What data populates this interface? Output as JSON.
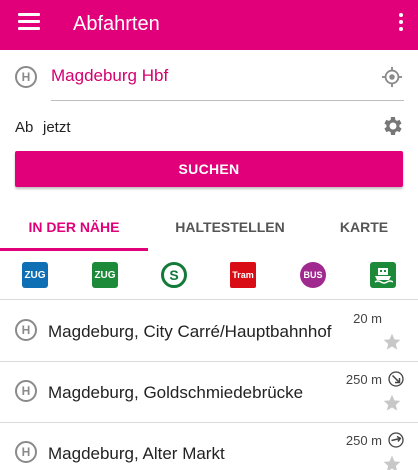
{
  "appbar": {
    "title": "Abfahrten",
    "menu_icon": "menu-icon",
    "more_icon": "more-vert-icon"
  },
  "search": {
    "station_icon": "H",
    "station_value": "Magdeburg Hbf",
    "time_label": "Ab",
    "time_value": "jetzt",
    "button_label": "SUCHEN"
  },
  "tabs": [
    {
      "label": "IN DER NÄHE",
      "active": true
    },
    {
      "label": "HALTESTELLEN",
      "active": false
    },
    {
      "label": "KARTE",
      "active": false
    }
  ],
  "modes": [
    {
      "label": "ZUG",
      "icon": "regional-train-icon"
    },
    {
      "label": "ZUG",
      "icon": "train-icon"
    },
    {
      "label": "S",
      "icon": "sbahn-icon"
    },
    {
      "label": "Tram",
      "icon": "tram-icon"
    },
    {
      "label": "BUS",
      "icon": "bus-icon"
    },
    {
      "label": "",
      "icon": "ferry-icon"
    }
  ],
  "stations": [
    {
      "icon": "H",
      "name": "Magdeburg, City Carré/Hauptbahnhof",
      "distance": "20 m",
      "direction_icon": ""
    },
    {
      "icon": "H",
      "name": "Magdeburg, Goldschmiedebrücke",
      "distance": "250 m",
      "direction_icon": "direction-southeast-icon"
    },
    {
      "icon": "H",
      "name": "Magdeburg, Alter Markt",
      "distance": "250 m",
      "direction_icon": "direction-east-icon"
    }
  ],
  "colors": {
    "accent": "#e2007a",
    "station_text": "#d4006e"
  }
}
